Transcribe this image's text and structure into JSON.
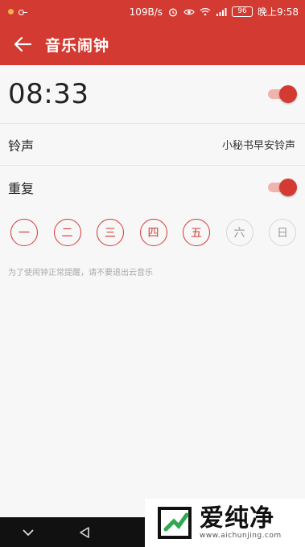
{
  "status_bar": {
    "network_speed": "109B/s",
    "battery": "96",
    "time": "晚上9:58"
  },
  "app_bar": {
    "title": "音乐闹钟"
  },
  "alarm": {
    "time": "08:33",
    "enabled": true
  },
  "ringtone": {
    "label": "铃声",
    "value": "小秘书早安铃声"
  },
  "repeat": {
    "label": "重复",
    "enabled": true,
    "days": [
      {
        "label": "一",
        "selected": true
      },
      {
        "label": "二",
        "selected": true
      },
      {
        "label": "三",
        "selected": true
      },
      {
        "label": "四",
        "selected": true
      },
      {
        "label": "五",
        "selected": true
      },
      {
        "label": "六",
        "selected": false
      },
      {
        "label": "日",
        "selected": false
      }
    ]
  },
  "hint": "为了使闹钟正常提醒，请不要退出云音乐",
  "colors": {
    "accent": "#d33a31",
    "accent_light": "#f1b4ad"
  },
  "watermark": {
    "title": "爱纯净",
    "url": "www.aichunjing.com"
  }
}
